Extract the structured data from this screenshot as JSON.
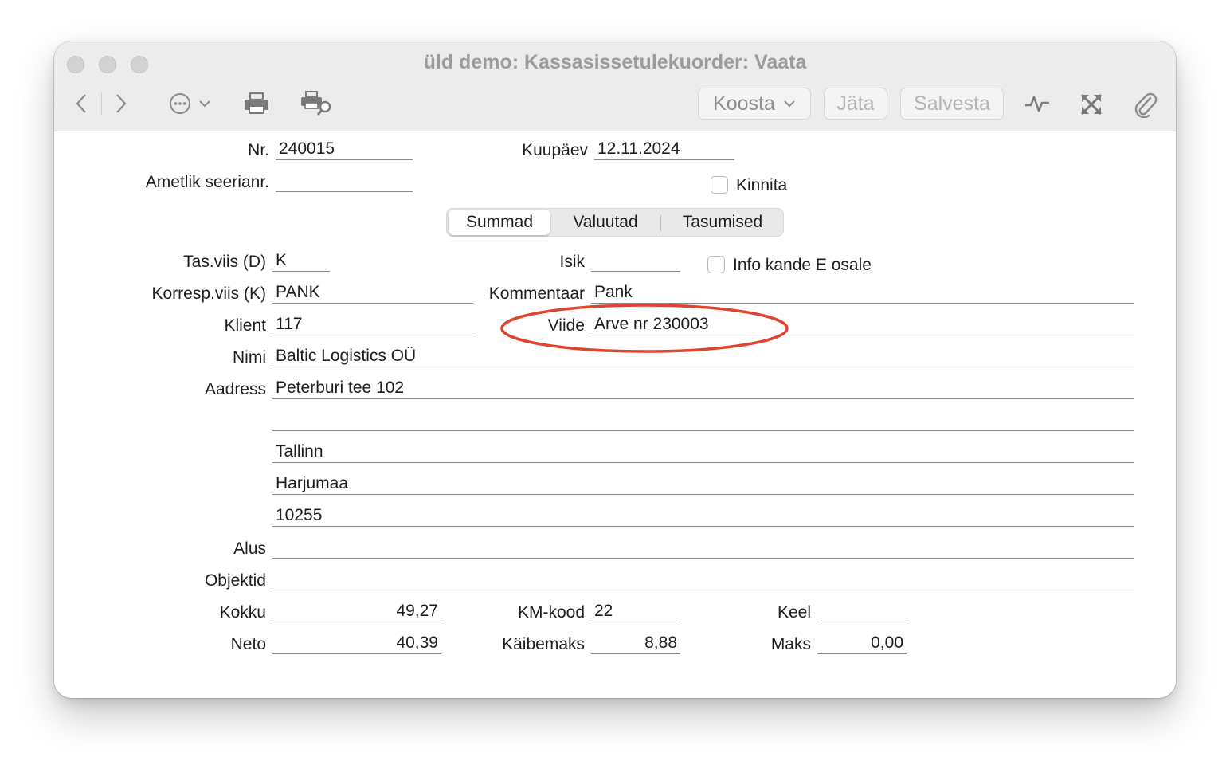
{
  "window": {
    "title": "üld demo: Kassasissetulekuorder: Vaata"
  },
  "toolbar": {
    "koosta_label": "Koosta",
    "jata_label": "Jäta",
    "salvesta_label": "Salvesta"
  },
  "tabs": [
    {
      "label": "Summad",
      "selected": true
    },
    {
      "label": "Valuutad",
      "selected": false
    },
    {
      "label": "Tasumised",
      "selected": false
    }
  ],
  "header": {
    "nr_label": "Nr.",
    "nr_value": "240015",
    "kuupaev_label": "Kuupäev",
    "kuupaev_value": "12.11.2024",
    "seerianr_label": "Ametlik seerianr.",
    "seerianr_value": "",
    "kinnita_label": "Kinnita",
    "kinnita_checked": false
  },
  "form": {
    "tasviis_label": "Tas.viis (D)",
    "tasviis_value": "K",
    "isik_label": "Isik",
    "isik_value": "",
    "info_label": "Info kande E osale",
    "info_checked": false,
    "korresp_label": "Korresp.viis (K)",
    "korresp_value": "PANK",
    "kommentaar_label": "Kommentaar",
    "kommentaar_value": "Pank",
    "klient_label": "Klient",
    "klient_value": "117",
    "viide_label": "Viide",
    "viide_value": "Arve nr 230003",
    "nimi_label": "Nimi",
    "nimi_value": "Baltic Logistics OÜ",
    "aadress_label": "Aadress",
    "address_lines": [
      "Peterburi tee 102",
      "",
      "Tallinn",
      "Harjumaa",
      "10255"
    ],
    "alus_label": "Alus",
    "alus_value": "",
    "objektid_label": "Objektid",
    "objektid_value": "",
    "kokku_label": "Kokku",
    "kokku_value": "49,27",
    "kmkood_label": "KM-kood",
    "kmkood_value": "22",
    "keel_label": "Keel",
    "keel_value": "",
    "neto_label": "Neto",
    "neto_value": "40,39",
    "kaibemaks_label": "Käibemaks",
    "kaibemaks_value": "8,88",
    "maks_label": "Maks",
    "maks_value": "0,00"
  },
  "annotation": {
    "color": "#e0442f"
  }
}
